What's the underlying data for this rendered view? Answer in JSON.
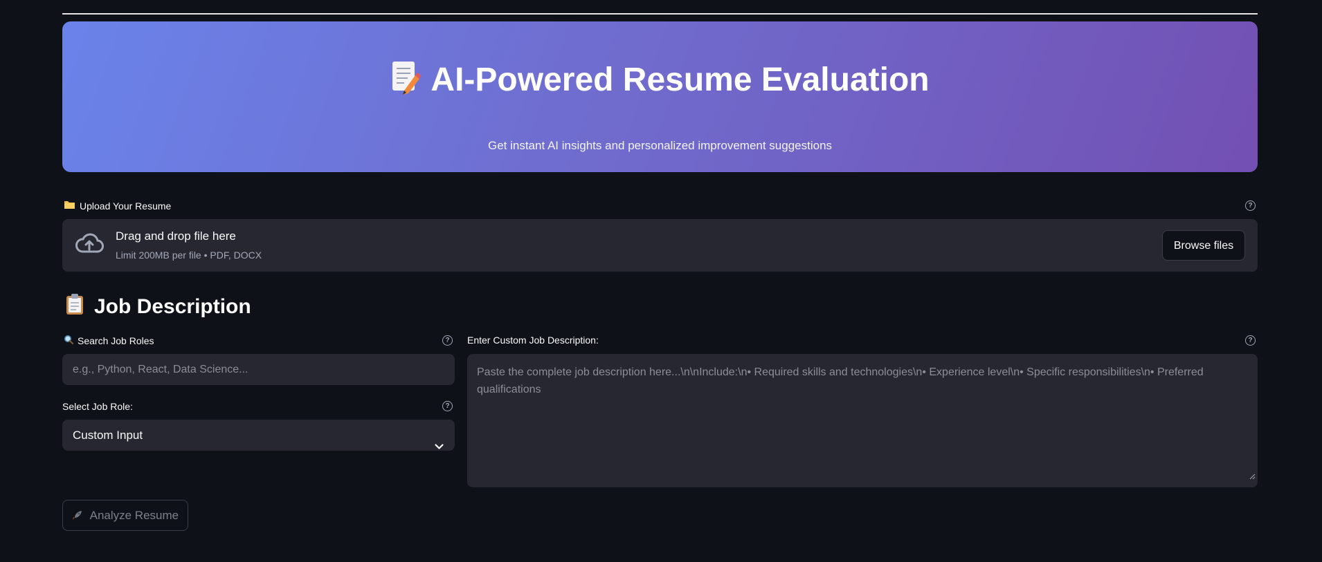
{
  "hero": {
    "title": "AI-Powered Resume Evaluation",
    "subtitle": "Get instant AI insights and personalized improvement suggestions"
  },
  "upload": {
    "label": "Upload Your Resume",
    "drop_text": "Drag and drop file here",
    "limit_text": "Limit 200MB per file • PDF, DOCX",
    "browse_label": "Browse files"
  },
  "job_section": {
    "title": "Job Description",
    "search_label": "Search Job Roles",
    "search_placeholder": "e.g., Python, React, Data Science...",
    "select_label": "Select Job Role:",
    "select_value": "Custom Input",
    "custom_label": "Enter Custom Job Description:",
    "custom_placeholder": "Paste the complete job description here...\\n\\nInclude:\\n• Required skills and technologies\\n• Experience level\\n• Specific responsibilities\\n• Preferred qualifications"
  },
  "actions": {
    "analyze_label": "Analyze Resume"
  },
  "colors": {
    "background": "#0e1117",
    "panel": "#262730",
    "hero_gradient_start": "#6a83ea",
    "hero_gradient_end": "#7350b3"
  }
}
